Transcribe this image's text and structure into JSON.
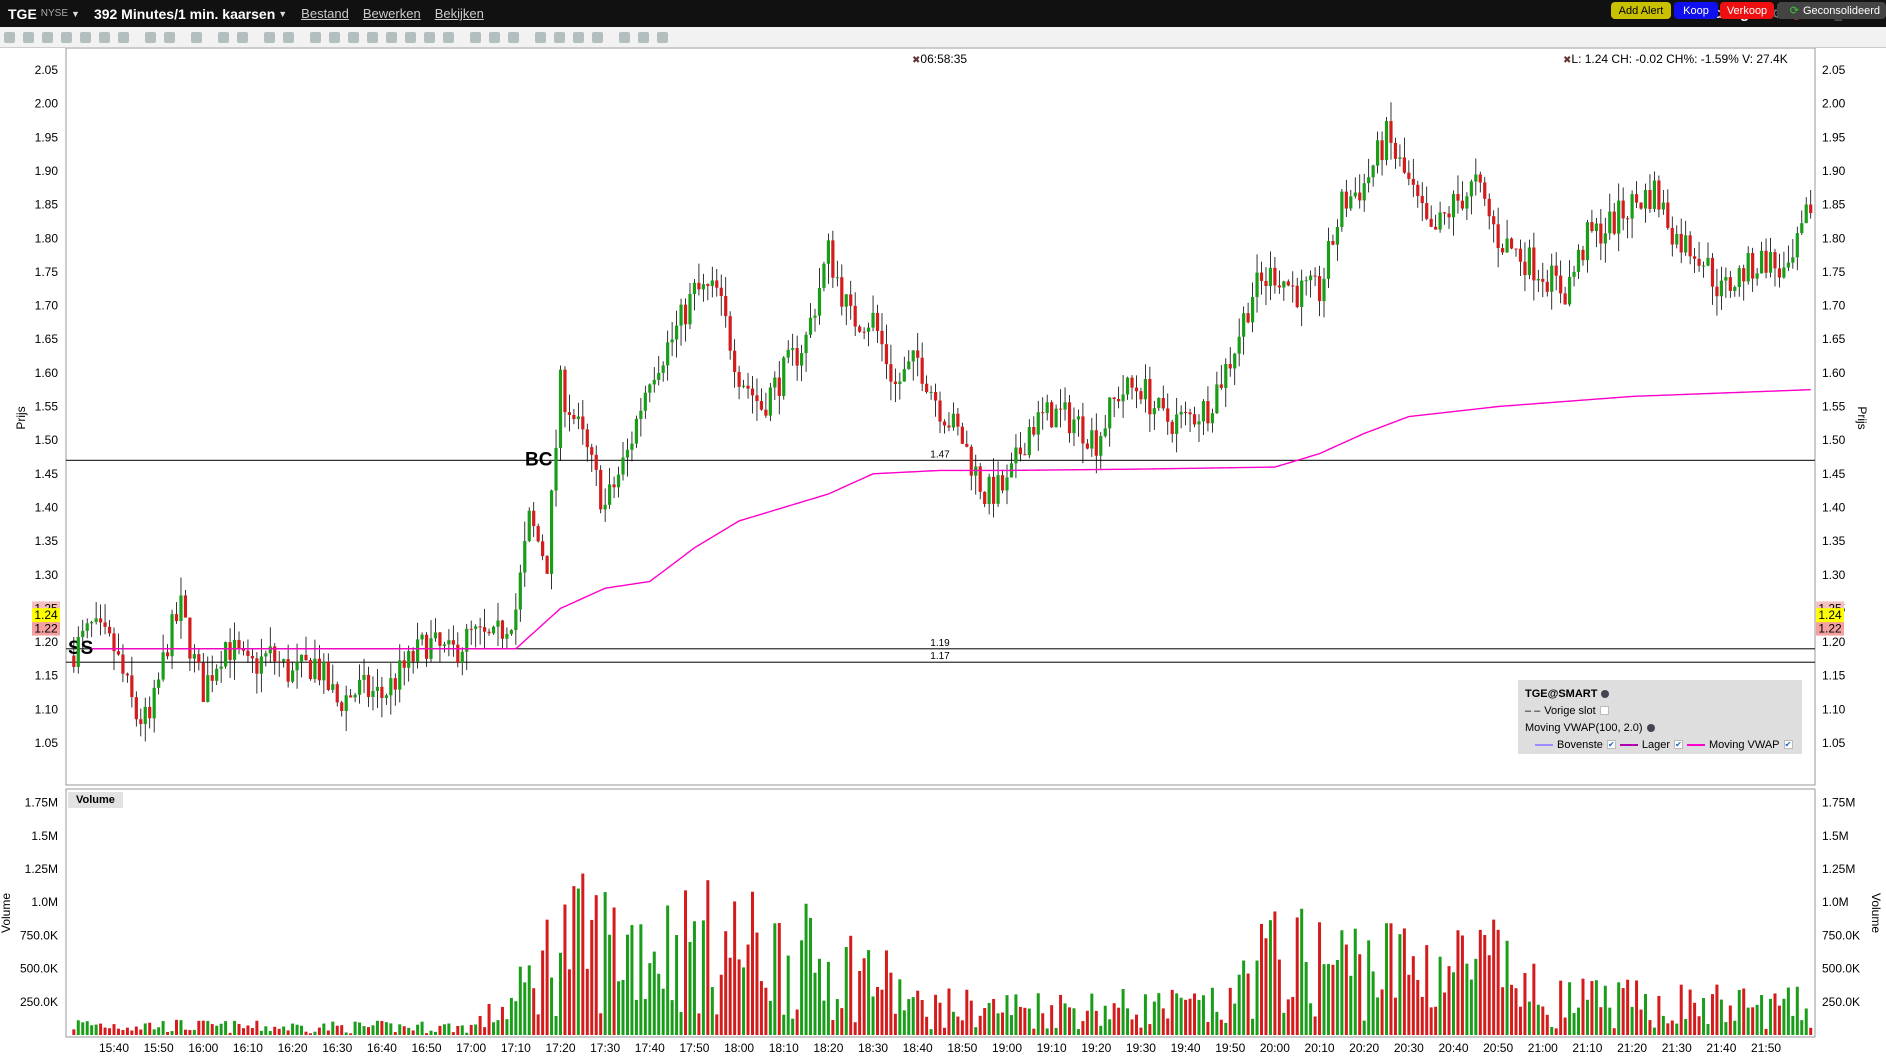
{
  "title": {
    "symbol": "TGE",
    "exchange": "NYSE",
    "period": "392 Minutes/1 min. kaarsen",
    "menus": [
      "Bestand",
      "Bewerken",
      "Bekijken"
    ],
    "range": "Vandaag"
  },
  "buttons": {
    "add_alert": "Add Alert",
    "buy": "Koop",
    "sell": "Verkoop",
    "consolidated": "Geconsolideerd"
  },
  "info": {
    "clock": "06:58:35",
    "quote": "L: 1.24 CH: -0.02 CH%: -1.59% V: 27.4K"
  },
  "legend": {
    "title": "TGE@SMART",
    "prev_close": "Vorige slot",
    "indicator": "Moving VWAP(100, 2.0)",
    "series": [
      "Bovenste",
      "Lager",
      "Moving VWAP"
    ]
  },
  "volume_label": "Volume",
  "colors": {
    "up": "#1a9e1a",
    "down": "#d41c1c",
    "vwap": "#ff00cc",
    "upper": "#9b8cff",
    "lower": "#b000b0"
  },
  "chart_data": {
    "type": "candlestick",
    "ylabel": "Prijs",
    "ylim": [
      1.0,
      2.07
    ],
    "yticks": [
      "2.05",
      "2.00",
      "1.95",
      "1.90",
      "1.85",
      "1.80",
      "1.75",
      "1.70",
      "1.65",
      "1.60",
      "1.55",
      "1.50",
      "1.45",
      "1.40",
      "1.35",
      "1.30",
      "1.25",
      "1.20",
      "1.15",
      "1.10",
      "1.05"
    ],
    "current_price": "1.24",
    "price_tags": [
      "1.25",
      "1.22"
    ],
    "hlines": [
      {
        "value": 1.47,
        "label": "1.47",
        "tag": "BC"
      },
      {
        "value": 1.19,
        "label": "1.19",
        "tag": "SS"
      },
      {
        "value": 1.17,
        "label": "1.17",
        "tag": ""
      }
    ],
    "x_start": "15:29",
    "x_end": "22:01",
    "xticks": [
      "15:40",
      "15:50",
      "16:00",
      "16:10",
      "16:20",
      "16:30",
      "16:40",
      "16:50",
      "17:00",
      "17:10",
      "17:20",
      "17:30",
      "17:40",
      "17:50",
      "18:00",
      "18:10",
      "18:20",
      "18:30",
      "18:40",
      "18:50",
      "19:00",
      "19:10",
      "19:20",
      "19:30",
      "19:40",
      "19:50",
      "20:00",
      "20:10",
      "20:20",
      "20:30",
      "20:40",
      "20:50",
      "21:00",
      "21:10",
      "21:20",
      "21:30",
      "21:40",
      "21:50"
    ],
    "price_path_min_from_1530": [
      [
        0,
        1.18
      ],
      [
        5,
        1.22
      ],
      [
        10,
        1.19
      ],
      [
        15,
        1.09
      ],
      [
        18,
        1.08
      ],
      [
        22,
        1.2
      ],
      [
        25,
        1.25
      ],
      [
        28,
        1.17
      ],
      [
        30,
        1.13
      ],
      [
        35,
        1.2
      ],
      [
        40,
        1.16
      ],
      [
        45,
        1.18
      ],
      [
        50,
        1.15
      ],
      [
        55,
        1.17
      ],
      [
        60,
        1.11
      ],
      [
        65,
        1.13
      ],
      [
        70,
        1.12
      ],
      [
        75,
        1.16
      ],
      [
        80,
        1.2
      ],
      [
        85,
        1.18
      ],
      [
        90,
        1.21
      ],
      [
        95,
        1.2
      ],
      [
        100,
        1.25
      ],
      [
        103,
        1.38
      ],
      [
        107,
        1.32
      ],
      [
        110,
        1.58
      ],
      [
        112,
        1.55
      ],
      [
        115,
        1.5
      ],
      [
        120,
        1.4
      ],
      [
        125,
        1.48
      ],
      [
        130,
        1.6
      ],
      [
        135,
        1.65
      ],
      [
        140,
        1.72
      ],
      [
        145,
        1.72
      ],
      [
        150,
        1.6
      ],
      [
        155,
        1.55
      ],
      [
        160,
        1.6
      ],
      [
        165,
        1.65
      ],
      [
        170,
        1.78
      ],
      [
        175,
        1.68
      ],
      [
        180,
        1.68
      ],
      [
        185,
        1.58
      ],
      [
        190,
        1.62
      ],
      [
        195,
        1.55
      ],
      [
        200,
        1.5
      ],
      [
        205,
        1.42
      ],
      [
        210,
        1.43
      ],
      [
        215,
        1.52
      ],
      [
        220,
        1.54
      ],
      [
        225,
        1.53
      ],
      [
        230,
        1.5
      ],
      [
        235,
        1.57
      ],
      [
        240,
        1.58
      ],
      [
        245,
        1.53
      ],
      [
        250,
        1.53
      ],
      [
        255,
        1.55
      ],
      [
        260,
        1.62
      ],
      [
        265,
        1.72
      ],
      [
        270,
        1.75
      ],
      [
        275,
        1.72
      ],
      [
        280,
        1.72
      ],
      [
        285,
        1.85
      ],
      [
        290,
        1.88
      ],
      [
        295,
        1.95
      ],
      [
        300,
        1.88
      ],
      [
        305,
        1.8
      ],
      [
        310,
        1.85
      ],
      [
        315,
        1.88
      ],
      [
        320,
        1.8
      ],
      [
        330,
        1.75
      ],
      [
        335,
        1.72
      ],
      [
        340,
        1.8
      ],
      [
        345,
        1.82
      ],
      [
        350,
        1.85
      ],
      [
        355,
        1.87
      ],
      [
        360,
        1.8
      ],
      [
        365,
        1.78
      ],
      [
        370,
        1.72
      ],
      [
        375,
        1.75
      ],
      [
        380,
        1.77
      ],
      [
        385,
        1.74
      ],
      [
        390,
        1.85
      ]
    ],
    "vwap_path": [
      [
        5,
        1.19
      ],
      [
        100,
        1.19
      ],
      [
        105,
        1.22
      ],
      [
        110,
        1.25
      ],
      [
        120,
        1.28
      ],
      [
        130,
        1.29
      ],
      [
        140,
        1.34
      ],
      [
        150,
        1.38
      ],
      [
        160,
        1.4
      ],
      [
        170,
        1.42
      ],
      [
        180,
        1.45
      ],
      [
        195,
        1.455
      ],
      [
        210,
        1.455
      ],
      [
        240,
        1.457
      ],
      [
        270,
        1.46
      ],
      [
        280,
        1.48
      ],
      [
        290,
        1.51
      ],
      [
        300,
        1.535
      ],
      [
        320,
        1.55
      ],
      [
        350,
        1.565
      ],
      [
        370,
        1.57
      ],
      [
        390,
        1.575
      ]
    ],
    "volume": {
      "ylabel": "Volume",
      "yticks": [
        "1.75M",
        "1.5M",
        "1.25M",
        "1.0M",
        "750.0K",
        "500.0K",
        "250.0K"
      ],
      "max_M": 1.78,
      "profile_K": [
        [
          0,
          80
        ],
        [
          40,
          60
        ],
        [
          90,
          60
        ],
        [
          100,
          250
        ],
        [
          110,
          700
        ],
        [
          150,
          650
        ],
        [
          180,
          450
        ],
        [
          190,
          200
        ],
        [
          260,
          200
        ],
        [
          265,
          550
        ],
        [
          320,
          500
        ],
        [
          330,
          250
        ],
        [
          392,
          200
        ]
      ]
    }
  }
}
